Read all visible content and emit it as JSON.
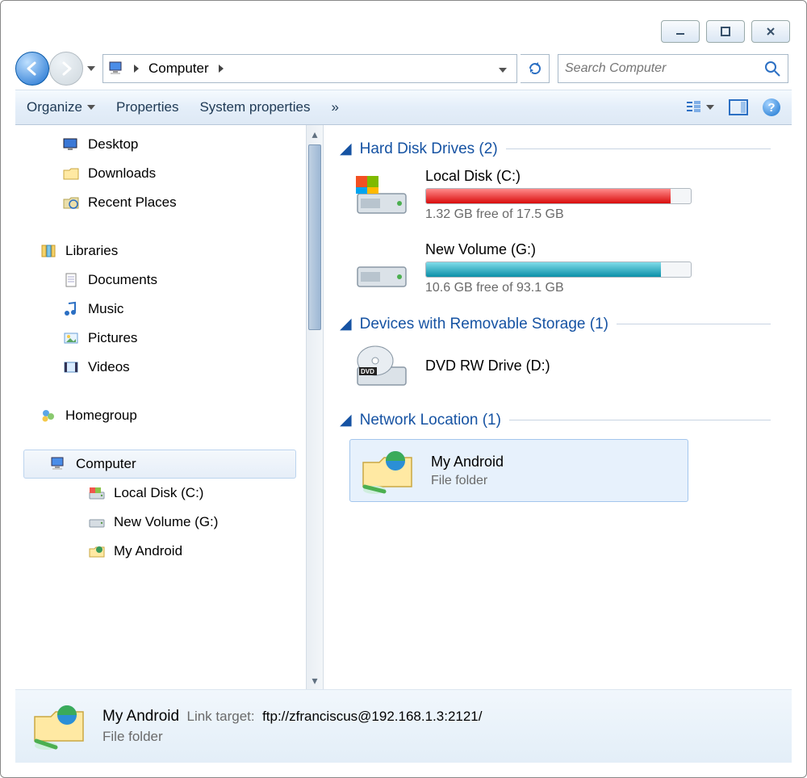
{
  "window_controls": {
    "minimize": "minimize",
    "maximize": "maximize",
    "close": "close"
  },
  "breadcrumb": {
    "root_icon": "computer-icon",
    "item": "Computer"
  },
  "search": {
    "placeholder": "Search Computer"
  },
  "toolbar": {
    "organize": "Organize",
    "properties": "Properties",
    "system_properties": "System properties",
    "more": "»"
  },
  "sidebar": {
    "desktop": "Desktop",
    "downloads": "Downloads",
    "recent": "Recent Places",
    "libraries": "Libraries",
    "documents": "Documents",
    "music": "Music",
    "pictures": "Pictures",
    "videos": "Videos",
    "homegroup": "Homegroup",
    "computer": "Computer",
    "local_disk": "Local Disk (C:)",
    "new_volume": "New Volume (G:)",
    "my_android": "My Android"
  },
  "sections": {
    "hdd": {
      "title": "Hard Disk Drives (2)",
      "count": 2
    },
    "removable": {
      "title": "Devices with Removable Storage (1)",
      "count": 1
    },
    "network": {
      "title": "Network Location (1)",
      "count": 1
    }
  },
  "drives": {
    "c": {
      "name": "Local Disk (C:)",
      "free_text": "1.32 GB free of 17.5 GB",
      "free_gb": 1.32,
      "total_gb": 17.5
    },
    "g": {
      "name": "New Volume (G:)",
      "free_text": "10.6 GB free of 93.1 GB",
      "free_gb": 10.6,
      "total_gb": 93.1
    },
    "dvd": {
      "name": "DVD RW Drive (D:)"
    },
    "android": {
      "name": "My Android",
      "type": "File folder"
    }
  },
  "status": {
    "title": "My Android",
    "link_label": "Link target:",
    "link_target": "ftp://zfranciscus@192.168.1.3:2121/",
    "type": "File folder"
  }
}
